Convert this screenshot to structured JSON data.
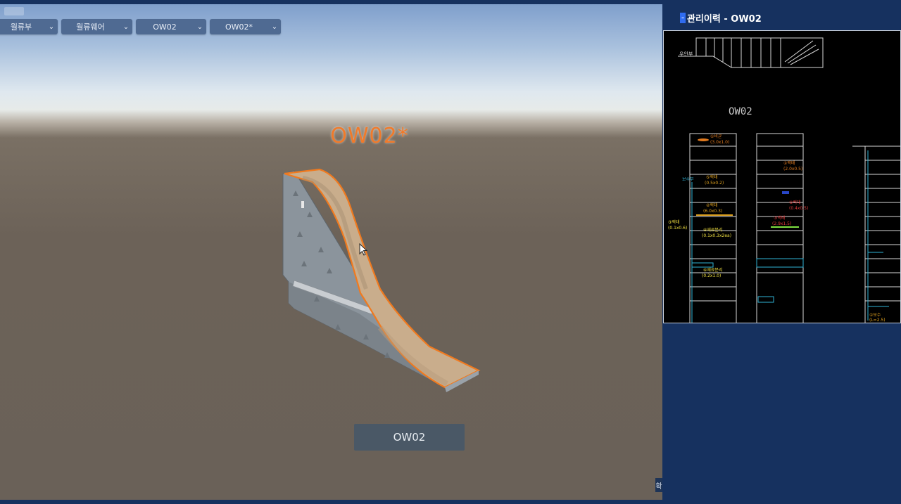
{
  "toolbar": {
    "dropdowns": [
      {
        "label": "월류부"
      },
      {
        "label": "월류웨어"
      },
      {
        "label": "OW02"
      },
      {
        "label": "OW02*"
      }
    ]
  },
  "viewport": {
    "model_label": "OW02*",
    "object_button": "OW02",
    "corner_button": "확"
  },
  "side_panel": {
    "title": "관리이력 - OW02",
    "drawing": {
      "section_label": "OW02",
      "top_label": "우안부",
      "annotations": [
        {
          "text": "①비균",
          "sub": "(3.0x1.0)",
          "color": "#e07a1f"
        },
        {
          "text": "⑤백태",
          "sub": "(0.5x0.2)",
          "color": "#e0a21f"
        },
        {
          "text": "②백태",
          "sub": "(6.0x0.3)",
          "color": "#e0a21f"
        },
        {
          "text": "③백태",
          "sub": "(0.1x0.6)",
          "color": "#f0e040"
        },
        {
          "text": "④재료분리",
          "sub": "(0.1x0.3x2ea)",
          "color": "#f0e040"
        },
        {
          "text": "⑥재료분리",
          "sub": "(0.2x1.0)",
          "color": "#f0e040"
        },
        {
          "text": "①백태",
          "sub": "(2.0x0.5)",
          "color": "#e07a1f"
        },
        {
          "text": "②백태",
          "sub": "(0.4x0.5)",
          "color": "#e23b3b"
        },
        {
          "text": "③백태",
          "sub": "(2.9x1.5)",
          "color": "#e23b3b"
        },
        {
          "text": "보수부",
          "sub": "",
          "color": "#2fb3d6"
        },
        {
          "text": "①보수",
          "sub": "(L=2.5)",
          "color": "#e0a21f"
        }
      ]
    }
  },
  "colors": {
    "accent_orange": "#f07a2a",
    "panel_bg": "#16315f",
    "dropdown_bg": "#4f6a92"
  }
}
